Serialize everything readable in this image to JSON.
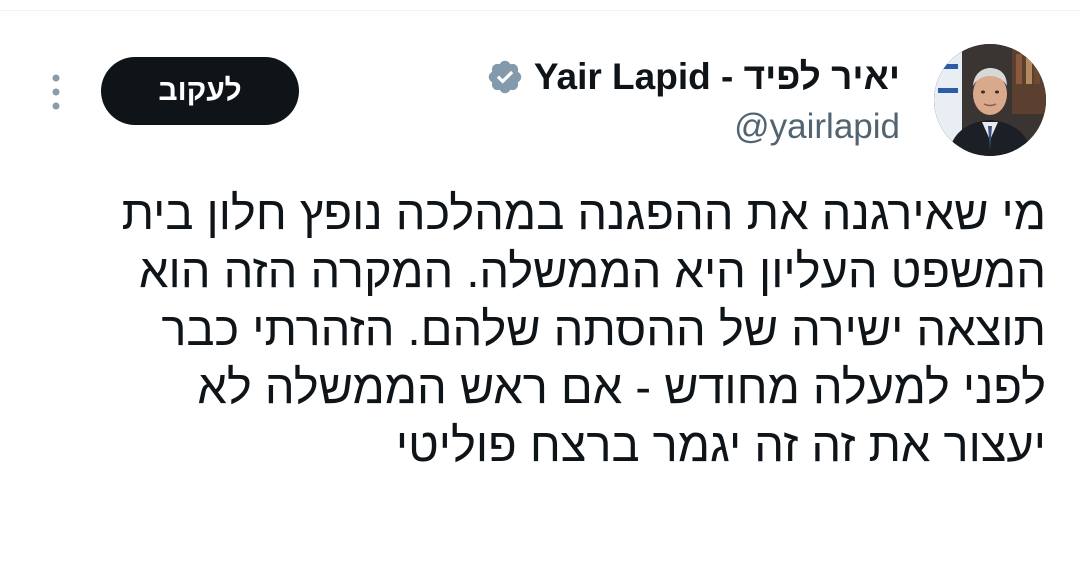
{
  "author": {
    "display_name": "יאיר לפיד - Yair Lapid",
    "handle": "@yairlapid",
    "verified_icon": "verified-badge-icon",
    "avatar": "avatar-photo"
  },
  "actions": {
    "follow_label": "לעקוב",
    "more_icon": "more-vertical-icon"
  },
  "tweet": {
    "lines": [
      "מי שאירגנה את ההפגנה במהלכה נופץ חלון בית",
      "המשפט העליון היא הממשלה. המקרה הזה הוא",
      "תוצאה ישירה של ההסתה שלהם. הזהרתי כבר",
      "לפני למעלה מחודש - אם ראש הממשלה לא",
      "יעצור את זה זה יגמר ברצח פוליטי"
    ]
  },
  "colors": {
    "text": "#0f1419",
    "secondary_text": "#536471",
    "follow_bg": "#0f1419",
    "verified": "#829aab",
    "more_dots": "#8a9ba8"
  }
}
